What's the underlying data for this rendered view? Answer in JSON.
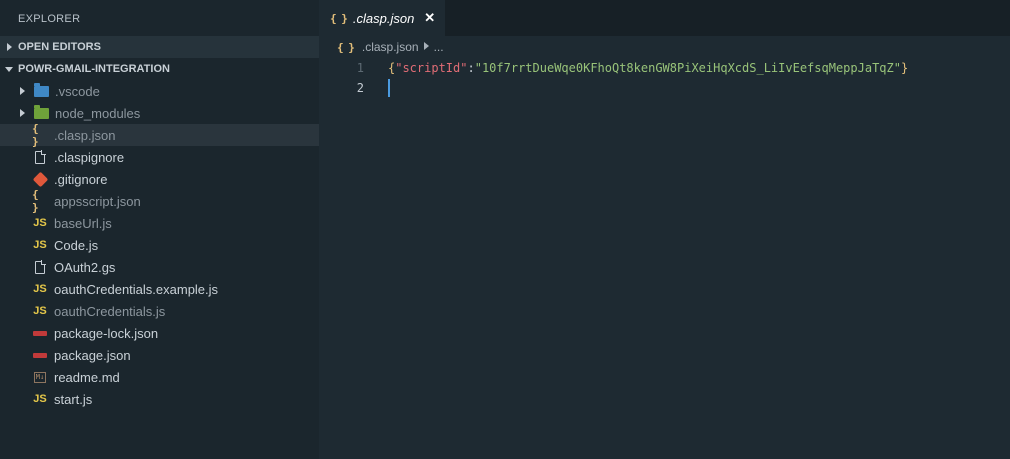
{
  "sidebar": {
    "title": "EXPLORER",
    "open_editors": "OPEN EDITORS",
    "project": "POWR-GMAIL-INTEGRATION",
    "items": [
      {
        "label": ".vscode",
        "type": "folder",
        "icon": "folder-vscode-icon"
      },
      {
        "label": "node_modules",
        "type": "folder",
        "icon": "folder-node-icon"
      },
      {
        "label": ".clasp.json",
        "type": "file",
        "icon": "json-braces-icon"
      },
      {
        "label": ".claspignore",
        "type": "file",
        "icon": "file-icon"
      },
      {
        "label": ".gitignore",
        "type": "file",
        "icon": "git-icon"
      },
      {
        "label": "appsscript.json",
        "type": "file",
        "icon": "json-braces-icon"
      },
      {
        "label": "baseUrl.js",
        "type": "file",
        "icon": "js-icon"
      },
      {
        "label": "Code.js",
        "type": "file",
        "icon": "js-icon"
      },
      {
        "label": "OAuth2.gs",
        "type": "file",
        "icon": "file-icon"
      },
      {
        "label": "oauthCredentials.example.js",
        "type": "file",
        "icon": "js-icon"
      },
      {
        "label": "oauthCredentials.js",
        "type": "file",
        "icon": "js-icon"
      },
      {
        "label": "package-lock.json",
        "type": "file",
        "icon": "npm-icon"
      },
      {
        "label": "package.json",
        "type": "file",
        "icon": "npm-icon"
      },
      {
        "label": "readme.md",
        "type": "file",
        "icon": "markdown-icon"
      },
      {
        "label": "start.js",
        "type": "file",
        "icon": "js-icon"
      }
    ]
  },
  "icons": {
    "braces": "{ }",
    "js": "JS",
    "md": "M↓",
    "close": "✕",
    "chevron": "›"
  },
  "editor": {
    "tab_label": ".clasp.json",
    "breadcrumb_file": ".clasp.json",
    "breadcrumb_more": "...",
    "line_numbers": [
      "1",
      "2"
    ],
    "line1": {
      "open": "{",
      "key": "\"scriptId\"",
      "colon": ":",
      "value": "\"10f7rrtDueWqe0KFhoQt8kenGW8PiXeiHqXcdS_LiIvEefsqMeppJaTqZ\"",
      "close": "}"
    }
  },
  "colors": {
    "sidebar_bg": "#1b262d",
    "editor_bg": "#1e2a32",
    "json_key": "#e06c75",
    "json_string": "#98c379",
    "brace": "#e5c07b",
    "cursor": "#4b9be0"
  }
}
